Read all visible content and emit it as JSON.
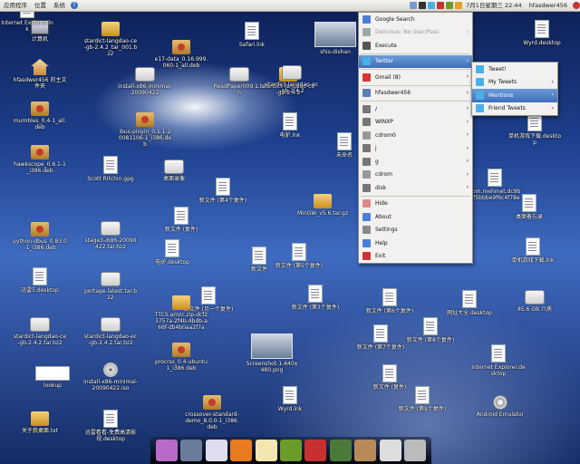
{
  "panel": {
    "menus": [
      "应用程序",
      "位置",
      "系统"
    ],
    "help_glyph": "?",
    "datetime": "7月1日星期三 22:44",
    "username": "hfasdwer456"
  },
  "desktop_icons": [
    {
      "label": "计算机",
      "type": "computer"
    },
    {
      "label": "hfasdwer456 的主文件夹",
      "type": "home"
    },
    {
      "label": "mumbles_0.4-1_all.deb",
      "type": "pkg"
    },
    {
      "label": "hawkscope_0.6.1-1_i386.deb",
      "type": "pkg"
    },
    {
      "label": "python-dbus_0.83.0-1_i386.deb",
      "type": "pkg"
    },
    {
      "label": "迅雷5.desktop",
      "type": "doc"
    },
    {
      "label": "stardict-langdao-ce-gb-2.4.2.tar.bz2",
      "type": "archive"
    },
    {
      "label": "lookup",
      "type": "lined"
    },
    {
      "label": "关于我桌面.txt",
      "type": "folder"
    },
    {
      "label": "stardict-langdao-ce-gb-2.4.2_tar_001.bz2",
      "type": "folder"
    },
    {
      "label": "install-x86-minimal-20090422",
      "type": "archive"
    },
    {
      "label": "Scott Ritchin.gpg",
      "type": "doc"
    },
    {
      "label": "stage3-i686-20090422.tar.bz2",
      "type": "archive"
    },
    {
      "label": "portage-latest.tar.bz2",
      "type": "archive"
    },
    {
      "label": "stardict-langdao-ec-gb-2.4.2.tar.bz2",
      "type": "archive"
    },
    {
      "label": "install-x86-minimal-20090422.iso",
      "type": "disc"
    },
    {
      "label": "迅雷看看-免费高清影视.desktop",
      "type": "doc"
    },
    {
      "label": "e17-data_0.16.999.060-1_all.deb",
      "type": "pkg"
    },
    {
      "label": "ibus-pinyin_0.1.1-20081106-1_i386.deb",
      "type": "pkg"
    },
    {
      "label": "桌面录像",
      "type": "archive"
    },
    {
      "label": "新文件 (复件)",
      "type": "doc"
    },
    {
      "label": "电驴.desktop",
      "type": "doc"
    },
    {
      "label": "新文件 (另一个复件)",
      "type": "doc"
    },
    {
      "label": "TTCS.amzc.zip-dcf23757a-2f4b-4bdb-a66f-db4b0aa2f7a",
      "type": "folder"
    },
    {
      "label": "procrss_0.4-ubuntu1_i386.deb",
      "type": "pkg"
    },
    {
      "label": "crossover-standard-demo_8.0.0-1_i386.deb",
      "type": "pkg"
    },
    {
      "label": "Safari.lnk",
      "type": "doc"
    },
    {
      "label": "ReadPaper009.1.bin",
      "type": "archive"
    },
    {
      "label": "stardict-langdao-ce-gb-2.4.2",
      "type": "folder"
    },
    {
      "label": "新文件 (第4个复件)",
      "type": "doc"
    },
    {
      "label": "新文件",
      "type": "doc"
    },
    {
      "label": "Screenshot-1-640x480.png",
      "type": "thumb"
    },
    {
      "label": "Wyrd.lnk",
      "type": "doc"
    },
    {
      "label": "stardict-langdao-ec-gb-2.4.2",
      "type": "archive"
    },
    {
      "label": "电驴.lnk",
      "type": "doc"
    },
    {
      "label": "MinGW_v5.6.tar.gz",
      "type": "folder"
    },
    {
      "label": "新文件 (第5个复件)",
      "type": "doc"
    },
    {
      "label": "新文件 (第3个复件)",
      "type": "doc"
    },
    {
      "label": "新文件 (第6个复件)",
      "type": "doc"
    },
    {
      "label": "新文件 (复件)",
      "type": "doc"
    },
    {
      "label": "shis-dishan",
      "type": "thumb"
    },
    {
      "label": "未命名",
      "type": "doc"
    },
    {
      "label": "新文件 (第7个复件)",
      "type": "doc"
    },
    {
      "label": "新文件 (第8个复件)",
      "type": "doc"
    },
    {
      "label": "新文件 (第9个复件)",
      "type": "doc"
    },
    {
      "label": "网址大全.desktop",
      "type": "doc"
    },
    {
      "label": "Wyrd.desktop",
      "type": "doc"
    },
    {
      "label": "单机游戏下载.desktop",
      "type": "doc"
    },
    {
      "label": "com.mehmet.dc9b8f5bbbe9f6c4f78e",
      "type": "doc"
    },
    {
      "label": "桌面备忘录",
      "type": "doc"
    },
    {
      "label": "单机游戏下载.lnk",
      "type": "doc"
    },
    {
      "label": "85.6 GB 介质",
      "type": "archive"
    },
    {
      "label": "Internet Explorer.desktop",
      "type": "doc"
    },
    {
      "label": "Android Emulator",
      "type": "gear"
    },
    {
      "label": "Internet Explorer.lnk",
      "type": "doc"
    }
  ],
  "main_menu": {
    "items": [
      {
        "label": "Google Search",
        "submenu": false,
        "disabled": false,
        "highlighted": false,
        "icon": "google-icon",
        "color": "#4a7fd8"
      },
      {
        "label": "Delicious: No User/Pass",
        "submenu": true,
        "disabled": true,
        "highlighted": false,
        "icon": "delicious-icon",
        "color": "#9aa"
      },
      {
        "label": "Execute",
        "submenu": false,
        "disabled": false,
        "highlighted": false,
        "icon": "execute-icon",
        "color": "#555"
      },
      {
        "sep": true
      },
      {
        "label": "Twitter",
        "submenu": true,
        "disabled": false,
        "highlighted": true,
        "icon": "twitter-icon",
        "color": "#4ab0e8"
      },
      {
        "sep": true
      },
      {
        "label": "Gmail (8)",
        "submenu": true,
        "disabled": false,
        "highlighted": false,
        "icon": "gmail-icon",
        "color": "#d33"
      },
      {
        "sep": true
      },
      {
        "label": "hfasdwer456",
        "submenu": true,
        "disabled": false,
        "highlighted": false,
        "icon": "home-folder-icon",
        "color": "#5b7fb5"
      },
      {
        "sep": true
      },
      {
        "label": "/",
        "submenu": true,
        "disabled": false,
        "highlighted": false,
        "icon": "drive-icon",
        "color": "#777"
      },
      {
        "label": "WINXP",
        "submenu": true,
        "disabled": false,
        "highlighted": false,
        "icon": "drive-icon",
        "color": "#777"
      },
      {
        "label": "cdrom0",
        "submenu": true,
        "disabled": false,
        "highlighted": false,
        "icon": "cdrom-icon",
        "color": "#999"
      },
      {
        "label": "j",
        "submenu": true,
        "disabled": false,
        "highlighted": false,
        "icon": "drive-icon",
        "color": "#777"
      },
      {
        "label": "g",
        "submenu": true,
        "disabled": false,
        "highlighted": false,
        "icon": "drive-icon",
        "color": "#777"
      },
      {
        "label": "cdrom",
        "submenu": true,
        "disabled": false,
        "highlighted": false,
        "icon": "cdrom-icon",
        "color": "#999"
      },
      {
        "label": "disk",
        "submenu": true,
        "disabled": false,
        "highlighted": false,
        "icon": "drive-icon",
        "color": "#777"
      },
      {
        "sep": true
      },
      {
        "label": "Hide",
        "submenu": false,
        "disabled": false,
        "highlighted": false,
        "icon": "hide-icon",
        "color": "#d88"
      },
      {
        "label": "About",
        "submenu": false,
        "disabled": false,
        "highlighted": false,
        "icon": "about-icon",
        "color": "#4a7fd8"
      },
      {
        "label": "Settings",
        "submenu": false,
        "disabled": false,
        "highlighted": false,
        "icon": "settings-icon",
        "color": "#888"
      },
      {
        "label": "Help",
        "submenu": false,
        "disabled": false,
        "highlighted": false,
        "icon": "help-icon",
        "color": "#4a7fd8"
      },
      {
        "label": "Exit",
        "submenu": false,
        "disabled": false,
        "highlighted": false,
        "icon": "exit-icon",
        "color": "#c33"
      }
    ]
  },
  "twitter_menu": {
    "items": [
      {
        "label": "Tweet!",
        "submenu": false,
        "highlighted": false,
        "color": "#4ab0e8"
      },
      {
        "label": "My Tweets",
        "submenu": true,
        "highlighted": false,
        "color": "#4ab0e8"
      },
      {
        "label": "Mentions",
        "submenu": true,
        "highlighted": true,
        "color": "#4ab0e8"
      },
      {
        "label": "Friend Tweets",
        "submenu": true,
        "highlighted": false,
        "color": "#4ab0e8"
      }
    ]
  },
  "dock": {
    "icons": [
      "settings-app-icon",
      "pidgin-icon",
      "mail-icon",
      "firefox-icon",
      "text-editor-icon",
      "terminal-icon",
      "presentation-icon",
      "book-icon",
      "package-icon",
      "clock-icon",
      "trash-icon"
    ],
    "colors": [
      "#b86ac8",
      "#6b7b9b",
      "#dde",
      "#e87a20",
      "#f3e6b0",
      "#6b9c2a",
      "#c83030",
      "#4a7a3a",
      "#b88a5a",
      "#ddd",
      "#bbb"
    ]
  },
  "arrow_glyph": "›"
}
